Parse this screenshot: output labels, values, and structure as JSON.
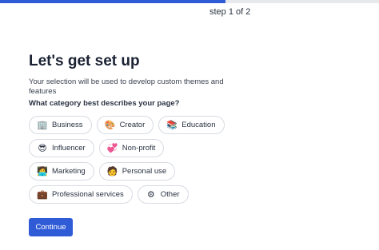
{
  "progress": {
    "fraction": 0.595,
    "label": "step 1 of 2"
  },
  "colors": {
    "accent": "#2f5bd7",
    "progress_track": "#e6e8ec"
  },
  "header": {
    "title": "Let's get set up"
  },
  "intro": {
    "subtitle": "Your selection will be used to develop custom themes and features"
  },
  "question": "What category best describes your page?",
  "categories": [
    {
      "label": "Business",
      "icon": "office-building-icon",
      "glyph": "🏢"
    },
    {
      "label": "Creator",
      "icon": "artist-palette-icon",
      "glyph": "🎨"
    },
    {
      "label": "Education",
      "icon": "books-icon",
      "glyph": "📚"
    },
    {
      "label": "Influencer",
      "icon": "sunglasses-face-icon",
      "glyph": "😎"
    },
    {
      "label": "Non-profit",
      "icon": "heart-icon",
      "glyph": "💞"
    },
    {
      "label": "Marketing",
      "icon": "person-at-laptop-icon",
      "glyph": "🧑‍💻"
    },
    {
      "label": "Personal use",
      "icon": "person-face-icon",
      "glyph": "🧑"
    },
    {
      "label": "Professional services",
      "icon": "briefcase-icon",
      "glyph": "💼"
    },
    {
      "label": "Other",
      "icon": "gear-icon",
      "glyph": "⚙"
    }
  ],
  "actions": {
    "continue_label": "Continue"
  }
}
